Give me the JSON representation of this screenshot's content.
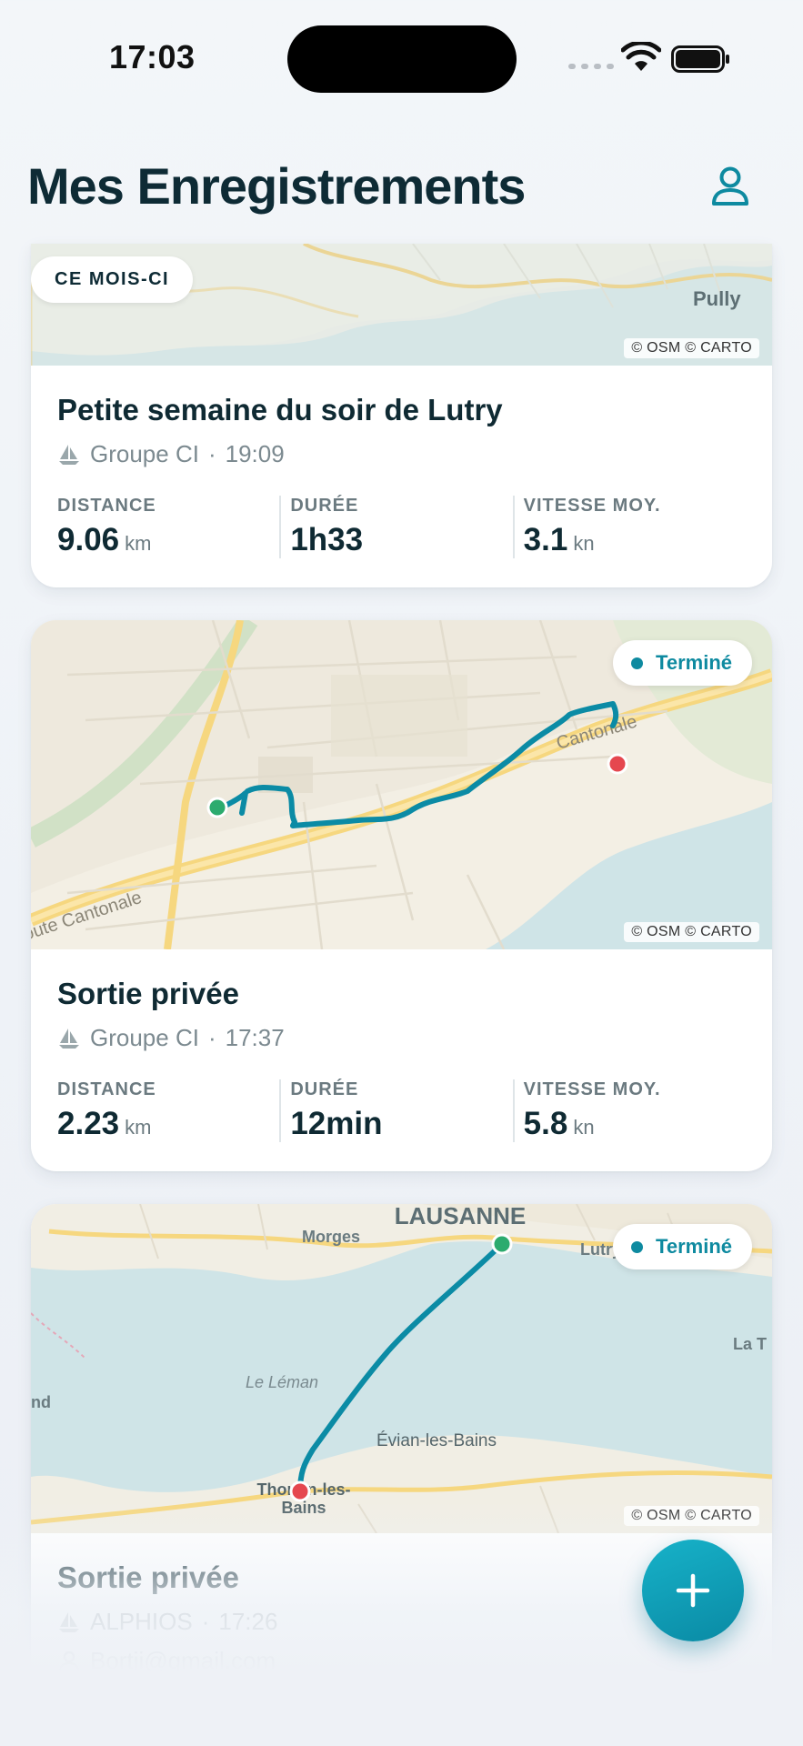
{
  "status_bar": {
    "time": "17:03"
  },
  "header": {
    "title": "Mes Enregistrements",
    "profile_icon": "person-icon"
  },
  "colors": {
    "accent": "#0e8aa0",
    "start_marker": "#2cab6e",
    "end_marker": "#e5474f",
    "track": "#0b8ba5"
  },
  "cards": [
    {
      "badge": "CE MOIS-CI",
      "map_labels": [
        "Pully"
      ],
      "attribution": "© OSM © CARTO",
      "title": "Petite semaine du soir de Lutry",
      "meta": {
        "group": "Groupe CI",
        "time": "19:09"
      },
      "stats": [
        {
          "label": "DISTANCE",
          "value": "9.06",
          "unit": "km"
        },
        {
          "label": "DURÉE",
          "value": "1h33",
          "unit": ""
        },
        {
          "label": "VITESSE MOY.",
          "value": "3.1",
          "unit": "kn"
        }
      ]
    },
    {
      "status": "Terminé",
      "map_labels": [
        "oute Cantonale",
        "Cantonale"
      ],
      "attribution": "© OSM © CARTO",
      "title": "Sortie privée",
      "meta": {
        "group": "Groupe CI",
        "time": "17:37"
      },
      "stats": [
        {
          "label": "DISTANCE",
          "value": "2.23",
          "unit": "km"
        },
        {
          "label": "DURÉE",
          "value": "12min",
          "unit": ""
        },
        {
          "label": "VITESSE MOY.",
          "value": "5.8",
          "unit": "kn"
        }
      ]
    },
    {
      "status": "Terminé",
      "map_labels": [
        "LAUSANNE",
        "Morges",
        "Lutry",
        "La T",
        "Le Léman",
        "nd",
        "Évian-les-Bains",
        "Thonon-les-",
        "Bains"
      ],
      "attribution": "© OSM © CARTO",
      "title": "Sortie privée",
      "meta": {
        "group": "ALPHIOS",
        "time": "17:26"
      },
      "email": "Bortji@gmail.com"
    }
  ],
  "fab": {
    "icon": "plus-icon"
  }
}
